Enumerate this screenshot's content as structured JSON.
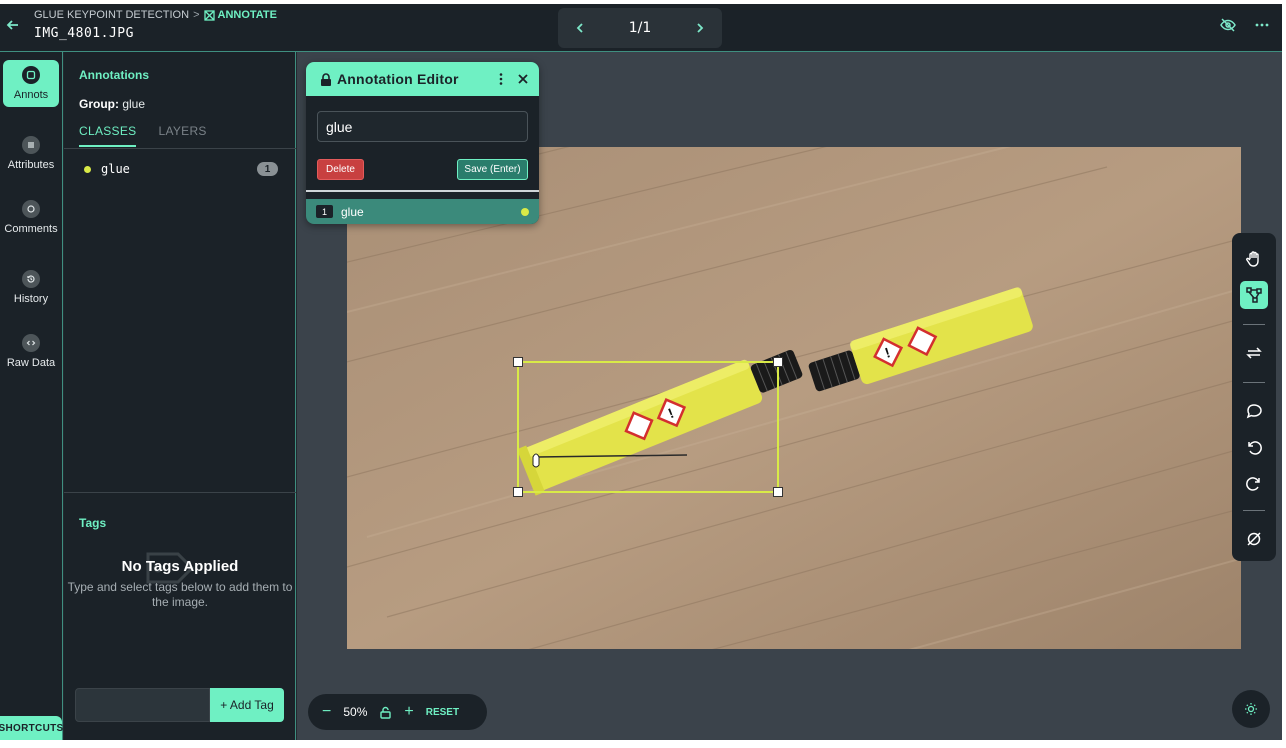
{
  "header": {
    "project": "GLUE KEYPOINT DETECTION",
    "mode": "ANNOTATE",
    "filename": "IMG_4801.JPG",
    "pager": "1/1"
  },
  "rail": {
    "items": [
      {
        "label": "Annots",
        "icon": "annotations-icon"
      },
      {
        "label": "Attributes",
        "icon": "list-icon"
      },
      {
        "label": "Comments",
        "icon": "comment-icon"
      },
      {
        "label": "History",
        "icon": "history-icon"
      },
      {
        "label": "Raw Data",
        "icon": "code-icon"
      }
    ],
    "shortcuts": "SHORTCUTS"
  },
  "panel": {
    "title": "Annotations",
    "group_label": "Group:",
    "group_value": "glue",
    "tabs": [
      "CLASSES",
      "LAYERS"
    ],
    "classes": [
      {
        "name": "glue",
        "count": "1"
      }
    ],
    "tags_title": "Tags",
    "no_tags_title": "No Tags Applied",
    "no_tags_text": "Type and select tags below to add them to the image.",
    "add_tag": "+ Add Tag"
  },
  "editor": {
    "title": "Annotation Editor",
    "input_value": "glue",
    "delete": "Delete",
    "save": "Save (Enter)",
    "row_number": "1",
    "row_name": "glue"
  },
  "zoom": {
    "minus": "−",
    "level": "50%",
    "plus": "+",
    "reset": "RESET"
  },
  "colors": {
    "accent": "#6ff0c3",
    "bbox": "#d9ea47",
    "delete": "#c84040"
  }
}
